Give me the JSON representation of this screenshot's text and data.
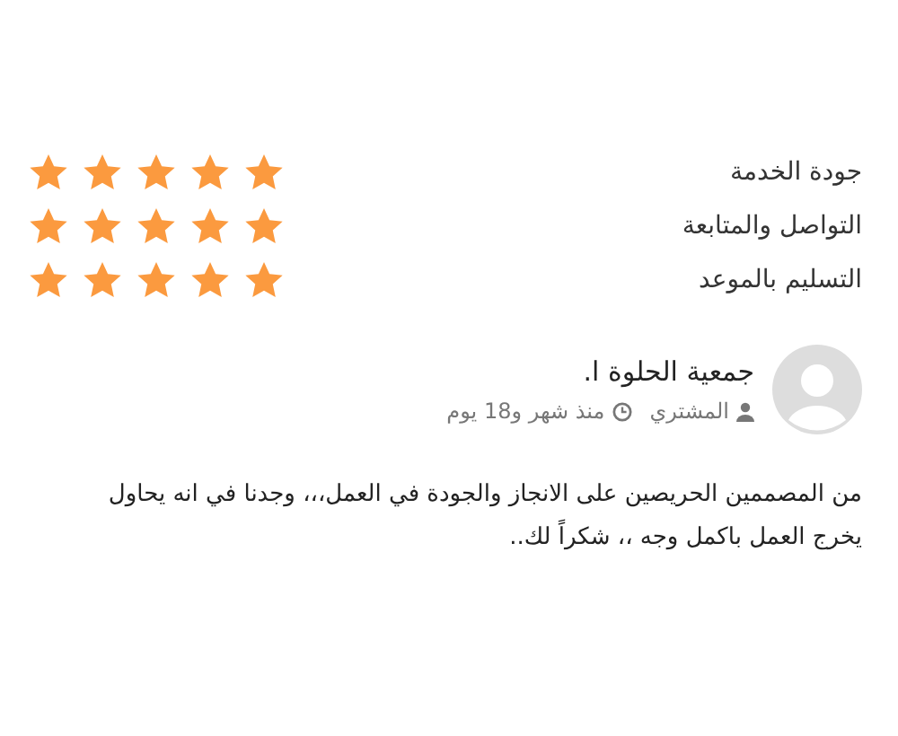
{
  "ratings": [
    {
      "label": "جودة الخدمة",
      "stars": 5
    },
    {
      "label": "التواصل والمتابعة",
      "stars": 5
    },
    {
      "label": "التسليم بالموعد",
      "stars": 5
    }
  ],
  "review": {
    "author": "جمعية الحلوة ا.",
    "role": "المشتري",
    "time": "منذ شهر و18 يوم",
    "comment": "من المصممين الحريصين على الانجاز والجودة في العمل،،، وجدنا في انه يحاول يخرج العمل باكمل وجه ،، شكراً لك.."
  }
}
